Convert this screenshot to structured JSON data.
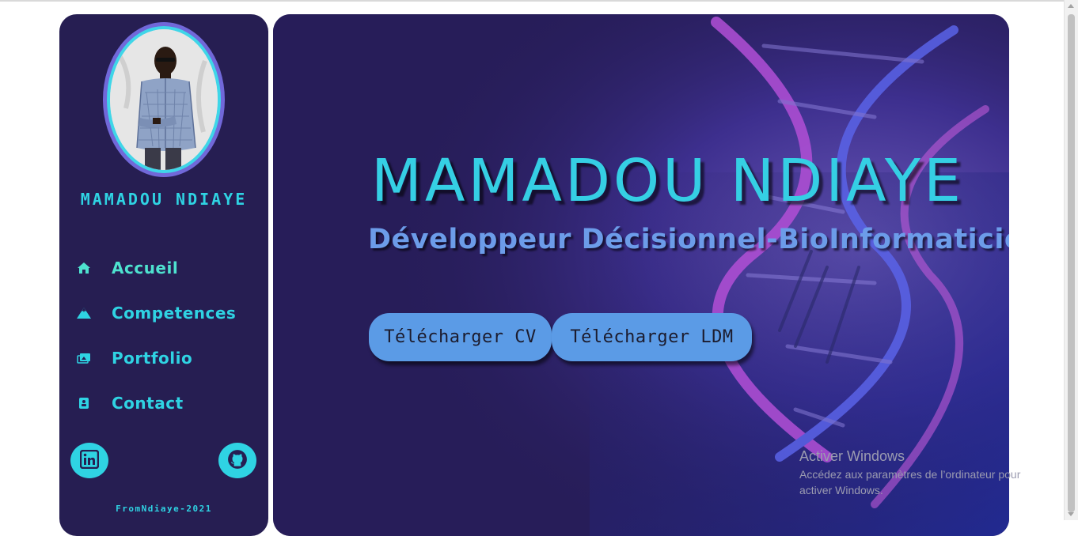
{
  "sidebar": {
    "name": "MAMADOU NDIAYE",
    "nav": [
      {
        "label": "Accueil",
        "icon": "home-icon"
      },
      {
        "label": "Competences",
        "icon": "mountain-icon"
      },
      {
        "label": "Portfolio",
        "icon": "images-icon"
      },
      {
        "label": "Contact",
        "icon": "address-book-icon"
      }
    ],
    "social": [
      {
        "name": "linkedin",
        "icon": "linkedin-icon"
      },
      {
        "name": "github",
        "icon": "github-icon"
      }
    ],
    "footer": "FromNdiaye-2021"
  },
  "hero": {
    "title": "MAMADOU NDIAYE",
    "subtitle": "Développeur Décisionnel-BioInformaticien",
    "buttons": {
      "cv": "Télécharger CV",
      "ldm": "Télécharger LDM"
    }
  },
  "watermark": {
    "title": "Activer Windows",
    "subtitle": "Accédez aux paramètres de l’ordinateur pour activer Windows."
  },
  "colors": {
    "panel": "#261e52",
    "accent": "#2fd3e3",
    "button": "#5b9be6",
    "title": "#35cfe4",
    "subtitle": "#6c9ce9"
  }
}
